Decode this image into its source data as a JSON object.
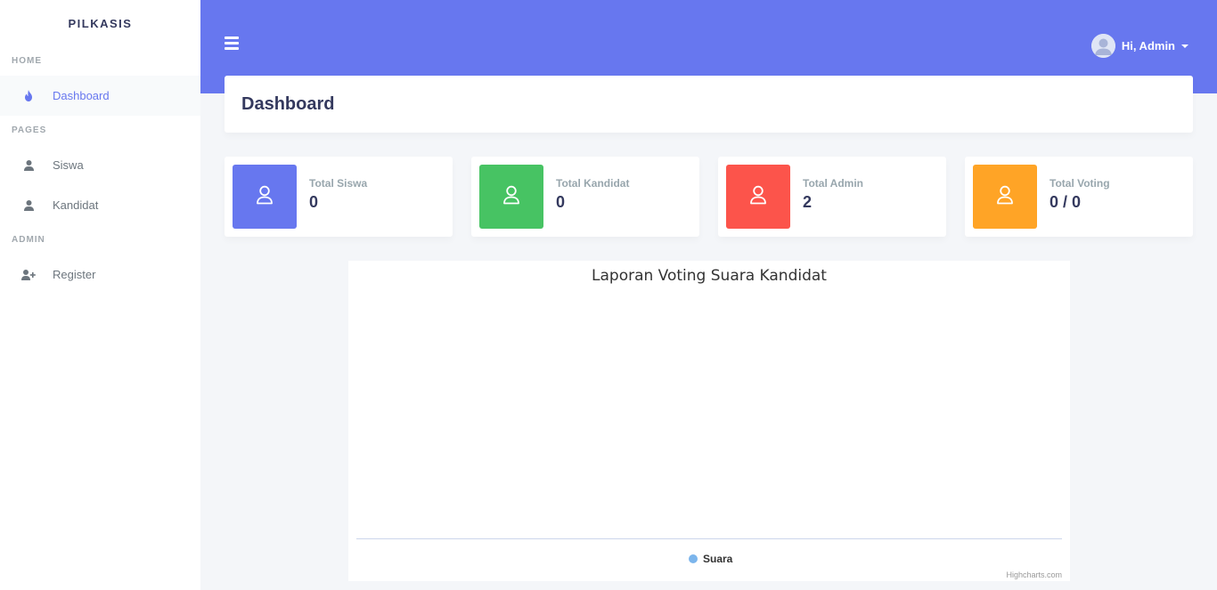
{
  "brand": "PILKASIS",
  "sidebar": {
    "sections": [
      {
        "header": "HOME",
        "items": [
          {
            "label": "Dashboard",
            "icon": "fire-icon",
            "active": true
          }
        ]
      },
      {
        "header": "PAGES",
        "items": [
          {
            "label": "Siswa",
            "icon": "user-icon"
          },
          {
            "label": "Kandidat",
            "icon": "user-icon"
          }
        ]
      },
      {
        "header": "ADMIN",
        "items": [
          {
            "label": "Register",
            "icon": "user-plus-icon"
          }
        ]
      }
    ]
  },
  "topbar": {
    "user_greeting": "Hi, Admin",
    "menu_icon": "hamburger-icon"
  },
  "page": {
    "title": "Dashboard"
  },
  "stats": [
    {
      "label": "Total Siswa",
      "value": "0",
      "color": "#6777ef",
      "icon": "user-icon"
    },
    {
      "label": "Total Kandidat",
      "value": "0",
      "color": "#47c363",
      "icon": "user-icon"
    },
    {
      "label": "Total Admin",
      "value": "2",
      "color": "#fc544b",
      "icon": "user-icon"
    },
    {
      "label": "Total Voting",
      "value": "0 / 0",
      "color": "#ffa426",
      "icon": "user-icon"
    }
  ],
  "chart_data": {
    "type": "bar",
    "title": "Laporan Voting Suara Kandidat",
    "categories": [],
    "series": [
      {
        "name": "Suara",
        "values": [],
        "color": "#7cb5ec"
      }
    ],
    "legend": "bottom-center",
    "credits": "Highcharts.com"
  },
  "colors": {
    "accent": "#6777ef",
    "background": "#f4f6f9"
  }
}
